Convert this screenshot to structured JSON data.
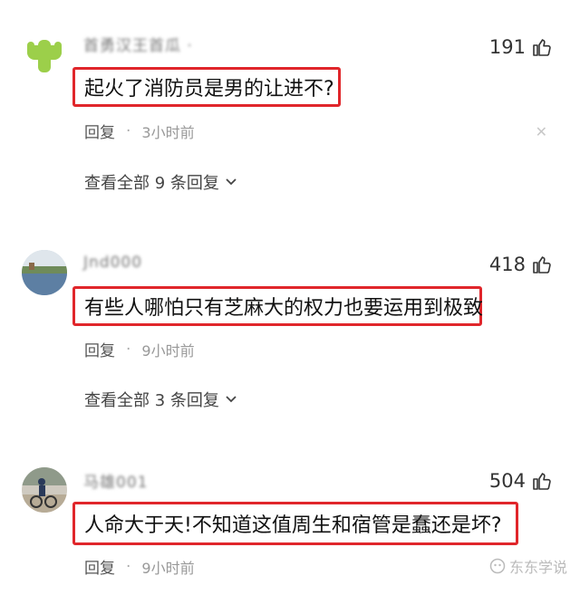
{
  "comments": [
    {
      "username": "首勇汉王首瓜 ·",
      "likes": "191",
      "text": "起火了消防员是男的让进不?",
      "reply_label": "回复",
      "dot": "·",
      "time": "3小时前",
      "view_replies": "查看全部 9 条回复"
    },
    {
      "username": "Jnd000",
      "likes": "418",
      "text": "有些人哪怕只有芝麻大的权力也要运用到极致",
      "reply_label": "回复",
      "dot": "·",
      "time": "9小时前",
      "view_replies": "查看全部 3 条回复"
    },
    {
      "username": "马雄001",
      "likes": "504",
      "text": "人命大于天!不知道这值周生和宿管是蠢还是坏?",
      "reply_label": "回复",
      "dot": "·",
      "time": "9小时前"
    }
  ],
  "watermark": "东东学说",
  "colors": {
    "highlight_border": "#e0262b",
    "text": "#111111",
    "muted": "#999999"
  },
  "icons": {
    "like": "thumbs-up-icon",
    "close": "close-icon",
    "chevron": "chevron-down-icon"
  }
}
